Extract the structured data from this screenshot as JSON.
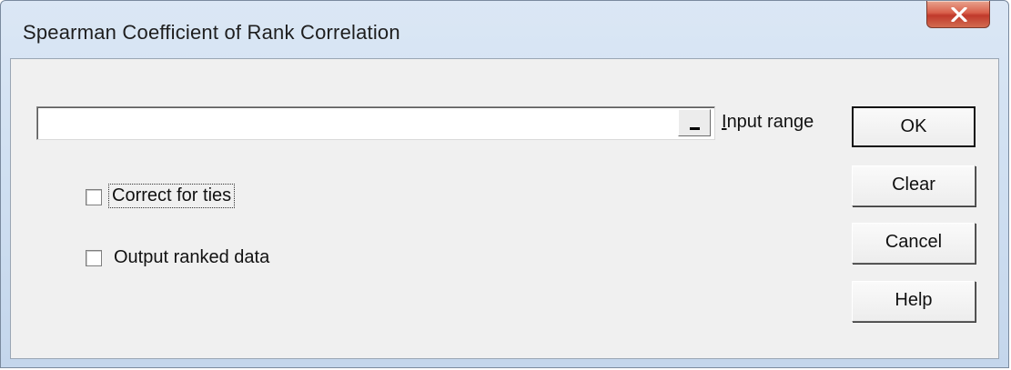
{
  "window": {
    "title": "Spearman Coefficient of Rank Correlation",
    "close_icon": "close-x-icon",
    "close_color": "#c0392b"
  },
  "input_range": {
    "value": "",
    "select_button_label": "_",
    "label_accel": "I",
    "label_rest": "nput range"
  },
  "options": {
    "correct_for_ties": {
      "label": "Correct for ties",
      "checked": false
    },
    "output_ranked_data": {
      "label": "Output ranked data",
      "checked": false
    }
  },
  "buttons": {
    "ok": "OK",
    "clear": "Clear",
    "cancel": "Cancel",
    "help": "Help"
  }
}
